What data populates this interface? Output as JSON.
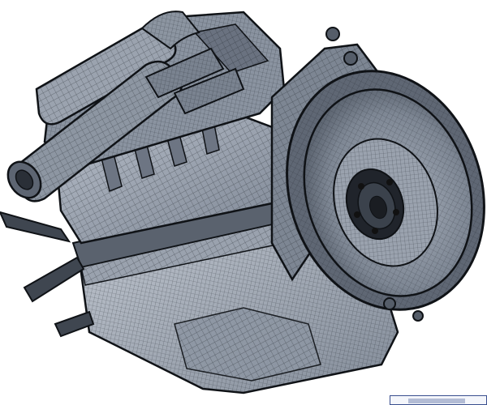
{
  "scene": {
    "subject": "engine-wireframe-render",
    "colors": {
      "background": "#ffffff",
      "metal_light": "#a9b1bd",
      "metal_mid": "#7f8896",
      "metal_dark": "#4a525d",
      "wire": "#1c2027",
      "edge": "#0f1216"
    }
  }
}
